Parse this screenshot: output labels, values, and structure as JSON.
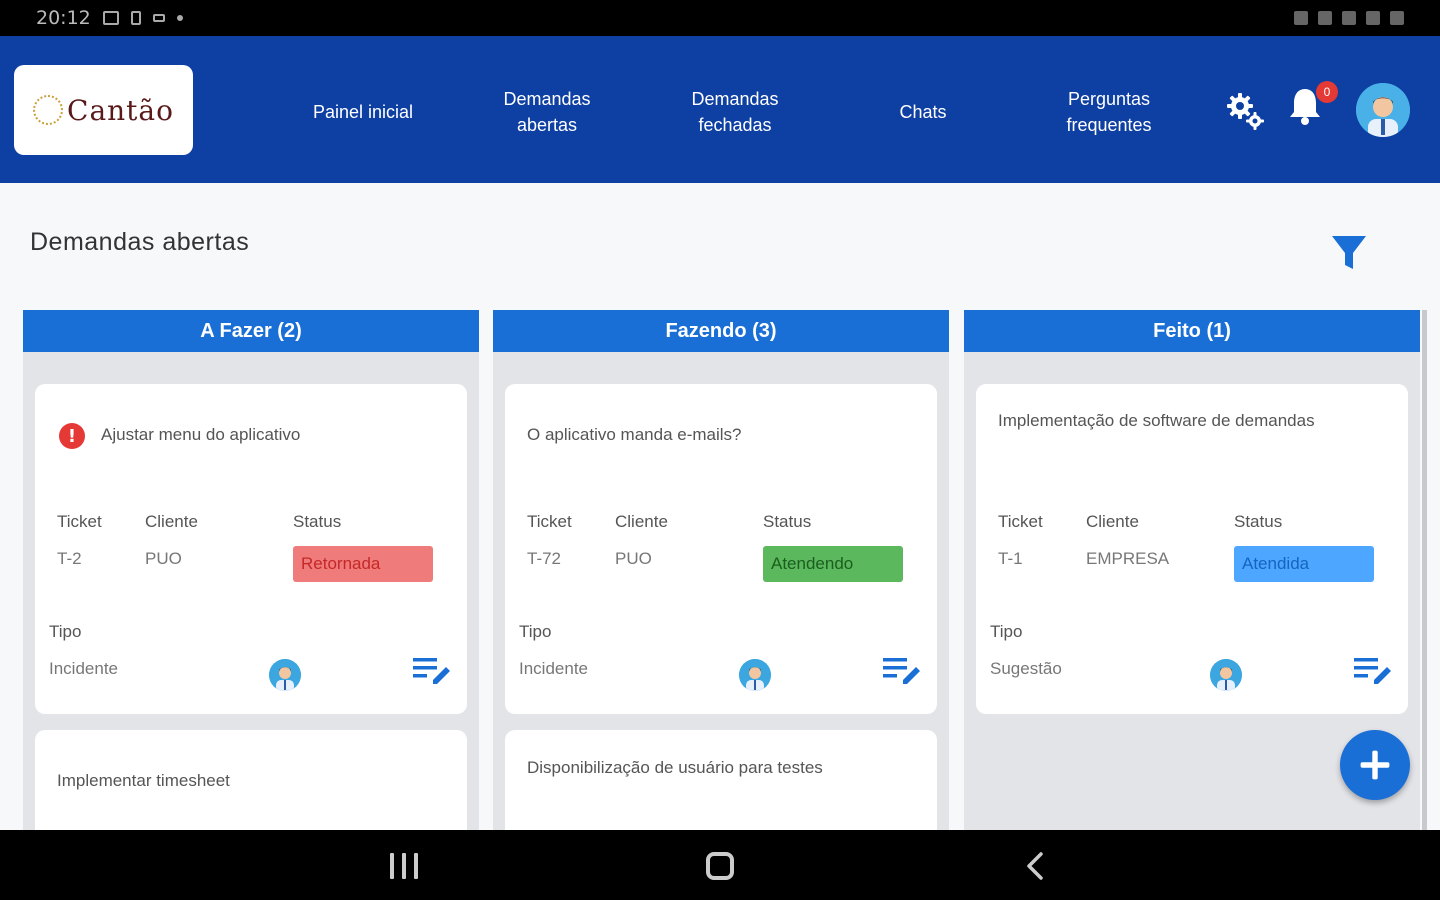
{
  "statusbar": {
    "time": "20:12"
  },
  "header": {
    "logo_text": "Cantão",
    "nav": [
      {
        "label": "Painel inicial"
      },
      {
        "label": "Demandas abertas"
      },
      {
        "label": "Demandas fechadas"
      },
      {
        "label": "Chats"
      },
      {
        "label": "Perguntas frequentes"
      }
    ],
    "notification_count": "0"
  },
  "page": {
    "title": "Demandas abertas"
  },
  "columns": [
    {
      "title": "A Fazer (2)",
      "cards": [
        {
          "title": "Ajustar menu do aplicativo",
          "priority_alert": true,
          "ticket_label": "Ticket",
          "cliente_label": "Cliente",
          "status_label": "Status",
          "ticket": "T-2",
          "cliente": "PUO",
          "status": "Retornada",
          "tipo_label": "Tipo",
          "tipo": "Incidente"
        },
        {
          "title": "Implementar timesheet"
        }
      ]
    },
    {
      "title": "Fazendo (3)",
      "cards": [
        {
          "title": "O aplicativo manda e-mails?",
          "ticket_label": "Ticket",
          "cliente_label": "Cliente",
          "status_label": "Status",
          "ticket": "T-72",
          "cliente": "PUO",
          "status": "Atendendo",
          "tipo_label": "Tipo",
          "tipo": "Incidente"
        },
        {
          "title": "Disponibilização de usuário para testes"
        }
      ]
    },
    {
      "title": "Feito (1)",
      "cards": [
        {
          "title": "Implementação de software de demandas",
          "ticket_label": "Ticket",
          "cliente_label": "Cliente",
          "status_label": "Status",
          "ticket": "T-1",
          "cliente": "EMPRESA",
          "status": "Atendida",
          "tipo_label": "Tipo",
          "tipo": "Sugestão"
        }
      ]
    }
  ],
  "colors": {
    "header_bg": "#0e3fa3",
    "column_header": "#1a6fd6",
    "status_retornada": "#ef7b7b",
    "status_atendendo": "#5cb85c",
    "status_atendida": "#4da6ff"
  },
  "icons": [
    "settings-gears-icon",
    "bell-icon",
    "user-avatar-icon",
    "filter-icon",
    "alert-icon",
    "edit-list-icon",
    "plus-icon"
  ]
}
